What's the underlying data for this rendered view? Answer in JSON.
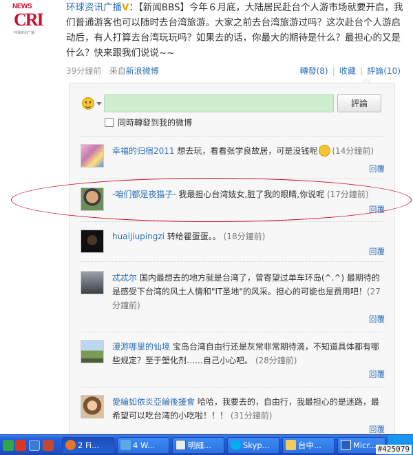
{
  "post": {
    "logo_top": "NEWS",
    "logo_main": "CRI",
    "logo_sub": "环球资讯广播",
    "author": "环球资讯广播",
    "vip_badge": "V",
    "body": "：【新闻BBS】今年６月底，大陆居民赴台个人游市场就要开启，我们普通游客也可以随时去台湾旅游。大家之前去台湾旅游过吗？这次赴台个人游启动后，有人打算去台湾玩玩吗？如果去的话，你最大的期待是什么？最担心的又是什么？快来跟我们说说~~",
    "time": "39分鐘前",
    "source_prefix": "来自",
    "source_link": "新浪微博",
    "repost": "轉發(8)",
    "favorite": "收藏",
    "comment": "評論(10)"
  },
  "composer": {
    "submit_label": "評論",
    "also_repost_label": "同時轉發到我的微博"
  },
  "comments": [
    {
      "name": "幸福的归宿2011",
      "text": " 想去玩，看看张学良故居，可是没钱呢",
      "has_emoji": true,
      "ago": "(14分鐘前)",
      "reply": "回覆"
    },
    {
      "name": "-咱们都是夜猫子-",
      "text": " 我最担心台湾妓女,脏了我的眼睛,你说呢",
      "has_emoji": false,
      "ago": "(17分鐘前)",
      "reply": "回覆"
    },
    {
      "name": "huaijiupingzi",
      "text": " 转给瞿蛋蛋。。",
      "has_emoji": false,
      "ago": "(18分鐘前)",
      "reply": "回覆"
    },
    {
      "name": "忒忒尔",
      "text": " 国内最想去的地方就是台湾了，曾寄望过单车环岛(^.^) 最期待的是感受下台湾的风土人情和\"IT圣地\"的风采。担心的可能也是费用吧！",
      "has_emoji": false,
      "ago": "(27分鐘前)",
      "reply": "回覆"
    },
    {
      "name": "漫游哪里的仙境",
      "text": " 宝岛台湾自由行还是灰常非常期待滴，不知道具体都有哪些规定？至于塑化剂……自己小心吧。",
      "has_emoji": false,
      "ago": "(28分鐘前)",
      "reply": "回覆"
    },
    {
      "name": "愛綸如依炎亞綸後援會",
      "text": " 哈哈，我要去的，自由行，我最担心的是迷路，最希望可以吃台湾的小吃啦！！！",
      "has_emoji": false,
      "ago": "(31分鐘前)",
      "reply": "回覆"
    }
  ],
  "taskbar": {
    "items": [
      "2 Fi...",
      "4 W...",
      "明細...",
      "Skyp...",
      "台中...",
      "Micr..."
    ]
  },
  "stamp": "#425079",
  "colors": {
    "link": "#2c6fb5",
    "annotation": "#c8102e",
    "taskbar": "#245edb"
  }
}
